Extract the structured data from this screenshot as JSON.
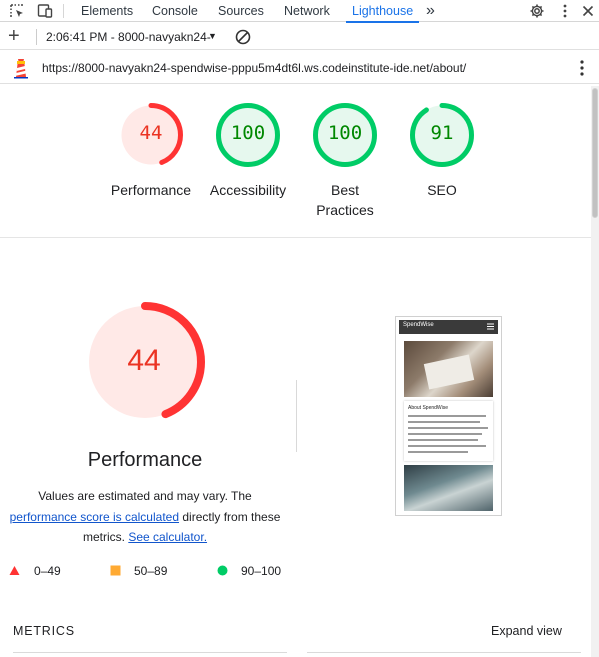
{
  "devtools": {
    "tabs": [
      "Elements",
      "Console",
      "Sources",
      "Network",
      "Lighthouse"
    ],
    "active_tab": "Lighthouse",
    "more_tabs": "»"
  },
  "toolbar": {
    "add": "+",
    "report_selector": "2:06:41 PM - 8000-navyakn24-",
    "caret": "▼"
  },
  "url": "https://8000-navyakn24-spendwise-pppu5m4dt6l.ws.codeinstitute-ide.net/about/",
  "gauges": [
    {
      "score": "44",
      "label": "Performance",
      "fraction": 0.44,
      "status": "fail"
    },
    {
      "score": "100",
      "label": "Accessibility",
      "fraction": 1.0,
      "status": "pass"
    },
    {
      "score": "100",
      "label": "Best Practices",
      "label_lines": [
        "Best",
        "Practices"
      ],
      "fraction": 1.0,
      "status": "pass"
    },
    {
      "score": "91",
      "label": "SEO",
      "fraction": 0.91,
      "status": "pass"
    }
  ],
  "performance": {
    "score": "44",
    "fraction": 0.44,
    "title": "Performance",
    "desc_pre": "Values are estimated and may vary. The",
    "desc_link": "performance score is calculated",
    "desc_mid": "directly from these",
    "desc_post": "metrics.",
    "calc_link": "See calculator."
  },
  "legend": [
    {
      "shape": "triangle",
      "range": "0–49",
      "color": "#ff3333"
    },
    {
      "shape": "square",
      "range": "50–89",
      "color": "#ffaa33"
    },
    {
      "shape": "circle",
      "range": "90–100",
      "color": "#00cc66"
    }
  ],
  "thumbnail": {
    "brand": "SpendWise",
    "card_title": "About SpendWise"
  },
  "metrics": {
    "header": "METRICS",
    "expand": "Expand view"
  },
  "colors": {
    "fail": "#ff3333",
    "fail_text": "#eb3323",
    "fail_bg": "#ffe9e7",
    "pass": "#00cc66",
    "pass_text": "#008800",
    "pass_bg": "#e6f8ee",
    "accent": "#1a73e8"
  }
}
